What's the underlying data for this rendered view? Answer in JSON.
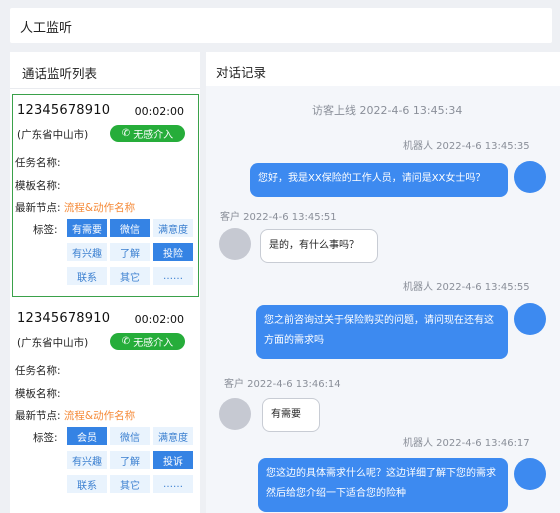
{
  "header": {
    "title": "人工监听"
  },
  "call_list": {
    "title": "通话监听列表",
    "cards": [
      {
        "phone": "12345678910",
        "duration": "00:02:00",
        "location": "(广东省中山市)",
        "intervene_label": "无感介入",
        "task_label": "任务名称:",
        "template_label": "模板名称:",
        "node_label": "最新节点:",
        "node_value": "流程&动作名称",
        "tags_label": "标签:",
        "tags": [
          {
            "label": "有需要",
            "active": true
          },
          {
            "label": "微信",
            "active": true
          },
          {
            "label": "满意度",
            "active": false
          },
          {
            "label": "有兴趣",
            "active": false
          },
          {
            "label": "了解",
            "active": false
          },
          {
            "label": "投险",
            "active": true
          },
          {
            "label": "联系",
            "active": false
          },
          {
            "label": "其它",
            "active": false
          },
          {
            "label": "……",
            "active": false
          }
        ]
      },
      {
        "phone": "12345678910",
        "duration": "00:02:00",
        "location": "(广东省中山市)",
        "intervene_label": "无感介入",
        "task_label": "任务名称:",
        "template_label": "模板名称:",
        "node_label": "最新节点:",
        "node_value": "流程&动作名称",
        "tags_label": "标签:",
        "tags": [
          {
            "label": "会员",
            "active": true
          },
          {
            "label": "微信",
            "active": false
          },
          {
            "label": "满意度",
            "active": false
          },
          {
            "label": "有兴趣",
            "active": false
          },
          {
            "label": "了解",
            "active": false
          },
          {
            "label": "投诉",
            "active": true
          },
          {
            "label": "联系",
            "active": false
          },
          {
            "label": "其它",
            "active": false
          },
          {
            "label": "……",
            "active": false
          }
        ]
      }
    ]
  },
  "conversation": {
    "title": "对话记录",
    "visitor_online": "访客上线   2022-4-6  13:45:34",
    "messages": [
      {
        "role": "bot",
        "meta": "机器人   2022-4-6  13:45:35",
        "text": "您好，我是XX保险的工作人员，请问是XX女士吗？"
      },
      {
        "role": "user",
        "meta": "客户   2022-4-6  13:45:51",
        "text": "是的，有什么事吗？"
      },
      {
        "role": "bot",
        "meta": "机器人   2022-4-6  13:45:55",
        "text": "您之前咨询过关于保险购买的问题，请问现在还有这方面的需求吗"
      },
      {
        "role": "user",
        "meta": "客户   2022-4-6  13:46:14",
        "text": "有需要"
      },
      {
        "role": "bot",
        "meta": "机器人   2022-4-6  13:46:17",
        "text": "您这边的具体需求什么呢？这边详细了解下您的需求然后给您介绍一下适合您的险种"
      }
    ]
  },
  "colors": {
    "accent_blue": "#3d8af0",
    "intervene_green": "#26ad3a",
    "node_orange": "#f58b3a",
    "active_border": "#3aa14a"
  }
}
